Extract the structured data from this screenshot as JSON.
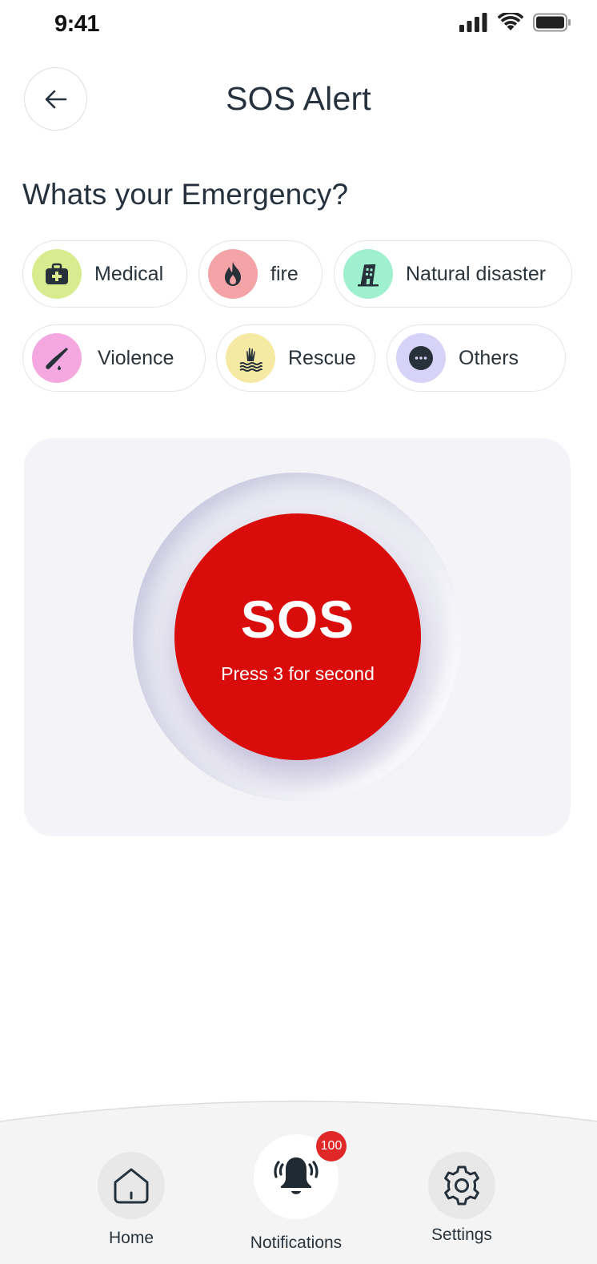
{
  "status_bar": {
    "time": "9:41"
  },
  "header": {
    "title": "SOS Alert"
  },
  "question": "Whats your Emergency?",
  "emergency_types": [
    {
      "label": "Medical",
      "icon": "medical-kit-icon",
      "color": "#d8ec8f"
    },
    {
      "label": "fire",
      "icon": "flame-icon",
      "color": "#f4a3a6"
    },
    {
      "label": "Natural disaster",
      "icon": "building-collapse-icon",
      "color": "#9ef0cf"
    },
    {
      "label": "Violence",
      "icon": "knife-icon",
      "color": "#f4a8df"
    },
    {
      "label": "Rescue",
      "icon": "drowning-hand-icon",
      "color": "#f6e9a4"
    },
    {
      "label": "Others",
      "icon": "more-dots-icon",
      "color": "#d6d2f8"
    }
  ],
  "sos": {
    "label": "SOS",
    "hint": "Press 3 for second",
    "color": "#d90b0b"
  },
  "bottom_nav": {
    "home_label": "Home",
    "notifications_label": "Notifications",
    "notifications_badge": "100",
    "settings_label": "Settings"
  }
}
